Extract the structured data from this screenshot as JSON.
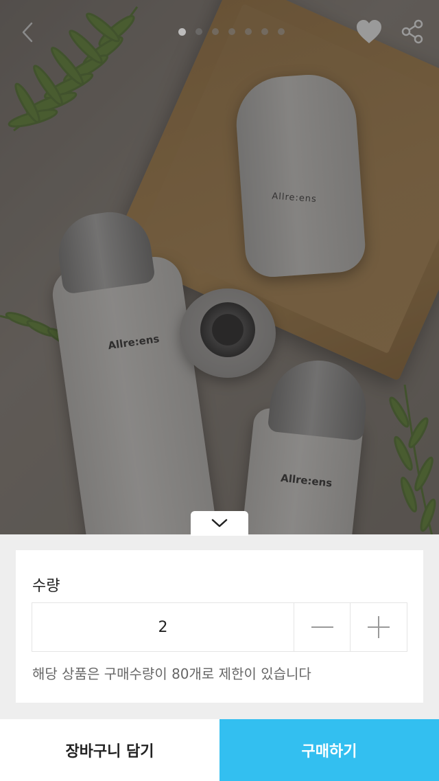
{
  "product_image": {
    "alt": "Allre:ens cosmetics product photo",
    "brand_print": "Allre:ens",
    "slide_count": 7,
    "active_slide": 1
  },
  "topbar": {
    "back_icon": "chevron-left-icon",
    "favorite_icon": "heart-icon",
    "share_icon": "share-icon"
  },
  "collapse_icon": "chevron-down-icon",
  "quantity": {
    "label": "수량",
    "value": "2",
    "minus_icon": "minus-icon",
    "plus_icon": "plus-icon",
    "limit_note": "해당 상품은 구매수량이 80개로 제한이 있습니다"
  },
  "actions": {
    "cart_label": "장바구니 담기",
    "buy_label": "구매하기"
  },
  "colors": {
    "accent": "#33bff0",
    "panel_bg": "#eeeeee",
    "card_bg": "#ffffff"
  }
}
